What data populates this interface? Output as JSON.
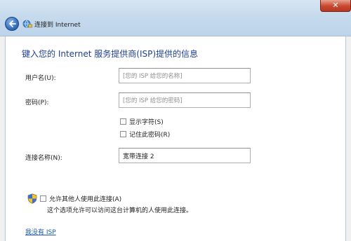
{
  "window": {
    "title": "连接到 Internet",
    "close_glyph": "✕"
  },
  "heading": "键入您的 Internet 服务提供商(ISP)提供的信息",
  "form": {
    "username_label": "用户名(U):",
    "username_value": "[您的 ISP 给您的名称]",
    "password_label": "密码(P):",
    "password_value": "[您的 ISP 给您的密码]",
    "show_chars_label": "显示字符(S)",
    "remember_password_label": "记住此密码(R)",
    "connection_name_label": "连接名称(N):",
    "connection_name_value": "宽带连接 2"
  },
  "sharing": {
    "allow_others_label": "允许其他人使用此连接(A)",
    "note": "这个选项允许可以访问这台计算机的人使用此连接。"
  },
  "link": "我没有 ISP",
  "icons": [
    "back-arrow-icon",
    "network-icon",
    "shield-icon",
    "close-icon"
  ]
}
